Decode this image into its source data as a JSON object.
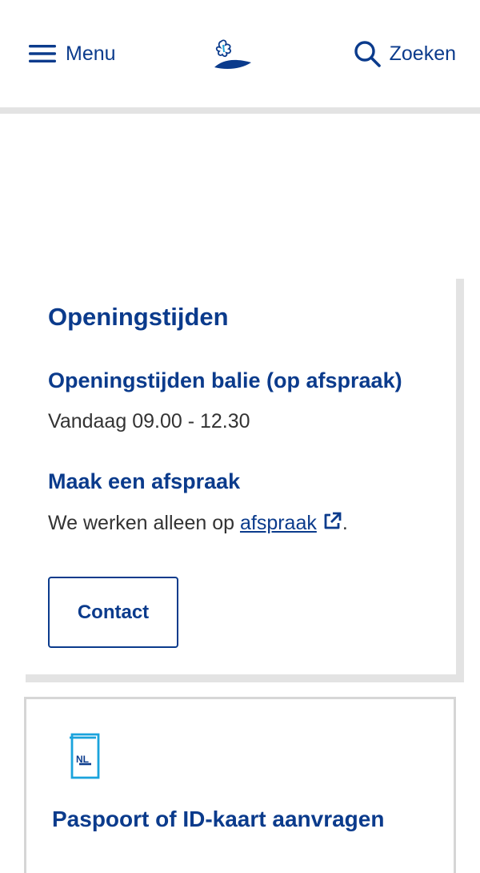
{
  "header": {
    "menu_label": "Menu",
    "search_label": "Zoeken",
    "logo_icon": "municipality-logo"
  },
  "hours": {
    "title": "Openingstijden",
    "desk_heading": "Openingstijden balie (op afspraak)",
    "desk_today": "Vandaag 09.00 - 12.30",
    "appointment_heading": "Maak een afspraak",
    "appointment_text_before": "We werken alleen op ",
    "appointment_link": "afspraak",
    "appointment_text_after": ".",
    "contact_button": "Contact"
  },
  "passport": {
    "icon_label": "NL",
    "title": "Paspoort of ID-kaart aanvragen"
  },
  "colors": {
    "brand_blue": "#0b3b8c",
    "icon_cyan": "#1aa3dc",
    "divider_gray": "#e3e3e3"
  }
}
